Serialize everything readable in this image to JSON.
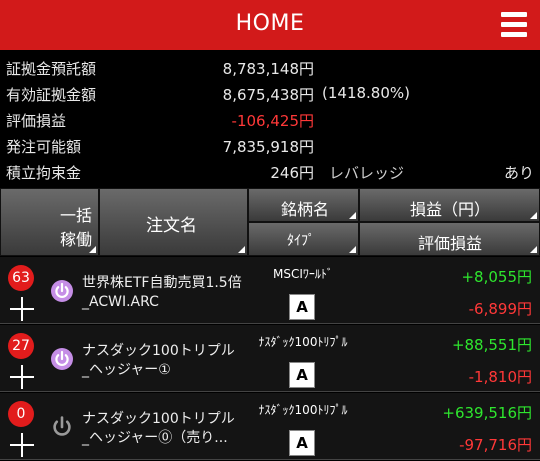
{
  "header": {
    "title": "HOME"
  },
  "icons": {
    "menu": "hamburger-menu-icon",
    "power": "power-icon",
    "add": "plus-icon"
  },
  "colors": {
    "brand_red": "#d21a1a",
    "loss": "#ff3838",
    "gain": "#2ee62e",
    "badge": "#e21c1c",
    "power_active": "#c58ee6",
    "power_inactive": "#9a9a9a"
  },
  "summary": {
    "margin_deposit_label": "証拠金預託額",
    "margin_deposit_value": "8,783,148円",
    "effective_margin_label": "有効証拠金額",
    "effective_margin_value": "8,675,438円",
    "effective_margin_pct": "(1418.80%)",
    "unrealized_label": "評価損益",
    "unrealized_value": "-106,425円",
    "orderable_label": "発注可能額",
    "orderable_value": "7,835,918円",
    "restricted_label": "積立拘束金",
    "restricted_value": "246円",
    "leverage_label": "レバレッジ",
    "leverage_value": "あり"
  },
  "table_header": {
    "bulk_line1": "一括",
    "bulk_line2": "稼働",
    "order_name": "注文名",
    "symbol": "銘柄名",
    "type": "ﾀｲﾌﾟ",
    "pl": "損益（円）",
    "eval_pl": "評価損益"
  },
  "rows": [
    {
      "count": "63",
      "active": true,
      "name_line1": "世界株ETF自動売買1.5倍",
      "name_line2": "_ACWI.ARC",
      "symbol": "MSCIﾜｰﾙﾄﾞ",
      "type": "A",
      "pl": "+8,055円",
      "eval_pl": "-6,899円"
    },
    {
      "count": "27",
      "active": true,
      "name_line1": "ナスダック100トリプル",
      "name_line2": "_ヘッジャー①",
      "symbol": "ﾅｽﾀﾞｯｸ100ﾄﾘﾌﾟﾙ",
      "type": "A",
      "pl": "+88,551円",
      "eval_pl": "-1,810円"
    },
    {
      "count": "0",
      "active": false,
      "name_line1": "ナスダック100トリプル",
      "name_line2": "_ヘッジャー⓪（売り...",
      "symbol": "ﾅｽﾀﾞｯｸ100ﾄﾘﾌﾟﾙ",
      "type": "A",
      "pl": "+639,516円",
      "eval_pl": "-97,716円"
    }
  ]
}
